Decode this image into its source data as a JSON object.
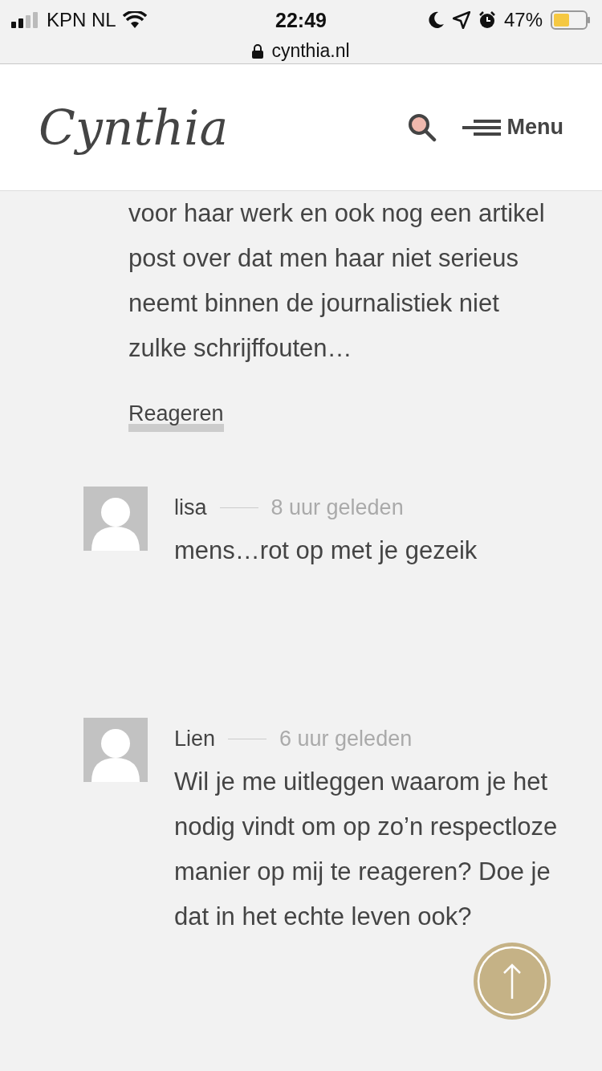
{
  "status_bar": {
    "carrier": "KPN NL",
    "time": "22:49",
    "battery": "47%"
  },
  "address_bar": {
    "url": "cynthia.nl"
  },
  "header": {
    "logo": "Cynthia",
    "menu_label": "Menu"
  },
  "comment_tail": {
    "text": "voor haar werk en ook nog een artikel post over dat men haar niet serieus neemt binnen de journalistiek niet zulke schrijffouten…",
    "reply_link": "Reageren"
  },
  "comments": [
    {
      "author": "lisa",
      "time": "8 uur geleden",
      "text": "mens…rot op met je gezeik"
    },
    {
      "author": "Lien",
      "time": "6 uur geleden",
      "text": "Wil je me uitleggen waarom je het nodig vindt om op zo’n respectloze manier op mij te reageren? Doe je dat in het echte leven ook?"
    }
  ]
}
